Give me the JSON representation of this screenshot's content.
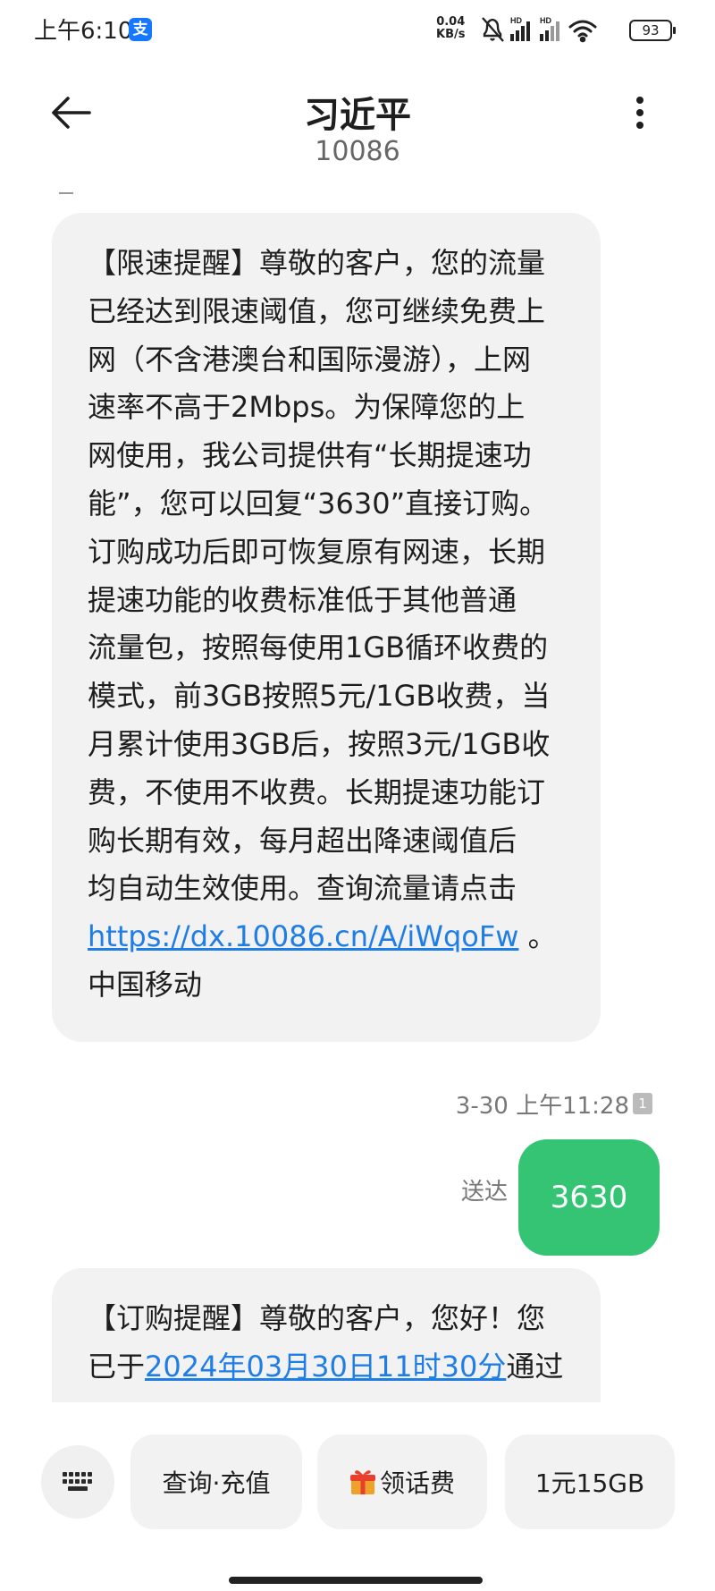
{
  "status_bar": {
    "time": "上午6:10",
    "alipay_glyph": "支",
    "net_speed_value": "0.04",
    "net_speed_unit": "KB/s",
    "signal_label_1": "HD",
    "signal_label_2": "HD",
    "battery": "93"
  },
  "header": {
    "contact_name": "习近平",
    "contact_number": "10086"
  },
  "messages": [
    {
      "direction": "incoming",
      "text_before_link": "【限速提醒】尊敬的客户，您的流量\n已经达到限速阈值，您可继续免费上\n网（不含港澳台和国际漫游），上网\n速率不高于2Mbps。为保障您的上\n网使用，我公司提供有“长期提速功\n能”，您可以回复“3630”直接订购。\n订购成功后即可恢复原有网速，长期\n提速功能的收费标准低于其他普通\n流量包，按照每使用1GB循环收费的\n模式，前3GB按照5元/1GB收费，当\n月累计使用3GB后，按照3元/1GB收\n费，不使用不收费。长期提速功能订\n购长期有效，每月超出降速阈值后\n均自动生效使用。查询流量请点击\n",
      "link": "https://dx.10086.cn/A/iWqoFw",
      "text_after_link": " 。\n中国移动"
    },
    {
      "direction": "outgoing",
      "timestamp": "3-30 上午11:28",
      "sim": "1",
      "status": "送达",
      "text": "3630"
    },
    {
      "direction": "incoming",
      "text_before_link": "【订购提醒】尊敬的客户，您好！您\n已于",
      "link": "2024年03月30日11时30分",
      "text_after_link": "通过"
    }
  ],
  "quick_replies": [
    {
      "label": "查询·充值"
    },
    {
      "label": "领话费",
      "icon": "gift-icon"
    },
    {
      "label": "1元15GB"
    }
  ],
  "colors": {
    "incoming_bubble": "#f2f2f2",
    "outgoing_bubble": "#34c474",
    "link": "#1f7ee6"
  }
}
